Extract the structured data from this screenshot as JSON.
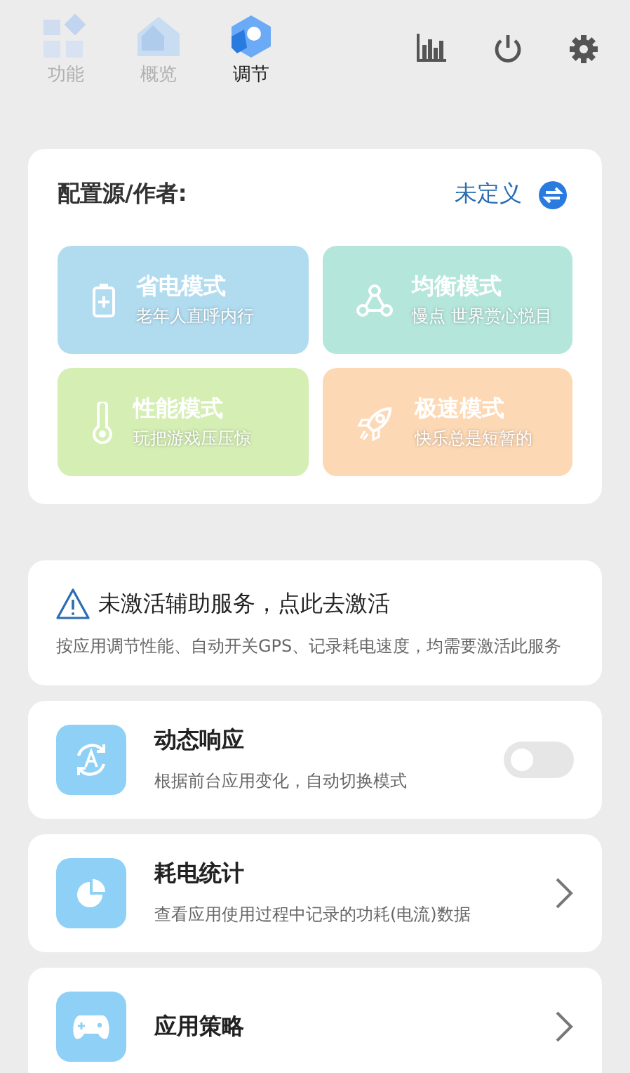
{
  "tabs": [
    {
      "label": "功能",
      "selected": false
    },
    {
      "label": "概览",
      "selected": false
    },
    {
      "label": "调节",
      "selected": true
    }
  ],
  "config": {
    "label": "配置源/作者:",
    "value": "未定义"
  },
  "modes": [
    {
      "title": "省电模式",
      "subtitle": "老年人直呼内行",
      "color": "#b1dcef"
    },
    {
      "title": "均衡模式",
      "subtitle": "慢点 世界赏心悦目",
      "color": "#b4e6dc"
    },
    {
      "title": "性能模式",
      "subtitle": "玩把游戏压压惊",
      "color": "#d4eeb4"
    },
    {
      "title": "极速模式",
      "subtitle": "快乐总是短暂的",
      "color": "#fdd8b4"
    }
  ],
  "notice": {
    "title": "未激活辅助服务，点此去激活",
    "text": "按应用调节性能、自动开关GPS、记录耗电速度，均需要激活此服务"
  },
  "items": [
    {
      "kind": "toggle",
      "title": "动态响应",
      "subtitle": "根据前台应用变化，自动切换模式",
      "on": false
    },
    {
      "kind": "chevron",
      "title": "耗电统计",
      "subtitle": "查看应用使用过程中记录的功耗(电流)数据"
    },
    {
      "kind": "chevron",
      "title": "应用策略"
    }
  ]
}
